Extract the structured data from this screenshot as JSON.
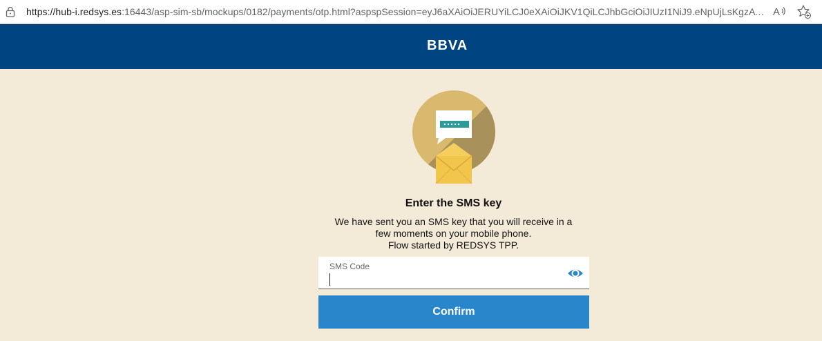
{
  "browser": {
    "url_host": "https://hub-i.redsys.es",
    "url_rest": ":16443/asp-sim-sb/mockups/0182/payments/otp.html?aspspSession=eyJ6aXAiOiJERUYiLCJ0eXAiOiJKV1QiLCJhbGciOiJIUzI1NiJ9.eNpUjLsKgzAYRt_ln80...",
    "icons": [
      "lock-icon",
      "read-aloud-icon",
      "favorite-star-icon"
    ]
  },
  "header": {
    "logo_text": "BBVA",
    "background_color": "#004481"
  },
  "main": {
    "illustration": "sms-envelope-illustration",
    "title": "Enter the SMS key",
    "description_lines": [
      "We have sent you an SMS key that you will receive in a",
      "few moments on your mobile phone.",
      "Flow started by REDSYS TPP."
    ],
    "sms_field": {
      "label": "SMS Code",
      "value": ""
    },
    "confirm_label": "Confirm",
    "accent_color": "#2a86ca",
    "background_color": "#f4ead8"
  }
}
